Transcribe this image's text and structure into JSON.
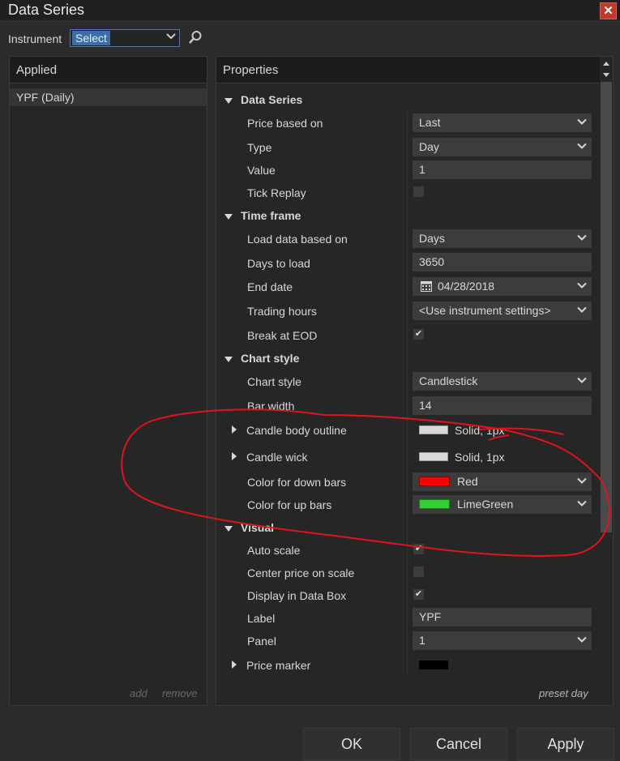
{
  "window": {
    "title": "Data Series",
    "close_icon": "close-icon"
  },
  "instrument": {
    "label": "Instrument",
    "value": "Select"
  },
  "applied": {
    "header": "Applied",
    "items": [
      "YPF (Daily)"
    ],
    "add_label": "add",
    "remove_label": "remove"
  },
  "properties": {
    "header": "Properties",
    "sections": {
      "data_series": "Data Series",
      "time_frame": "Time frame",
      "chart_style": "Chart style",
      "visual": "Visual"
    },
    "rows": {
      "price_based_on": {
        "label": "Price based on",
        "value": "Last"
      },
      "type": {
        "label": "Type",
        "value": "Day"
      },
      "value": {
        "label": "Value",
        "value": "1"
      },
      "tick_replay": {
        "label": "Tick Replay",
        "checked": false
      },
      "load_data_based_on": {
        "label": "Load data based on",
        "value": "Days"
      },
      "days_to_load": {
        "label": "Days to load",
        "value": "3650"
      },
      "end_date": {
        "label": "End date",
        "value": "04/28/2018"
      },
      "trading_hours": {
        "label": "Trading hours",
        "value": "<Use instrument settings>"
      },
      "break_at_eod": {
        "label": "Break at EOD",
        "checked": true
      },
      "chart_style": {
        "label": "Chart style",
        "value": "Candlestick"
      },
      "bar_width": {
        "label": "Bar width",
        "value": "14"
      },
      "candle_body_outline": {
        "label": "Candle body outline",
        "value": "Solid, 1px",
        "color": "#d9d9d9"
      },
      "candle_wick": {
        "label": "Candle wick",
        "value": "Solid, 1px",
        "color": "#d9d9d9"
      },
      "color_down_bars": {
        "label": "Color for down bars",
        "value": "Red",
        "color": "#ff0000"
      },
      "color_up_bars": {
        "label": "Color for up bars",
        "value": "LimeGreen",
        "color": "#32cd32"
      },
      "auto_scale": {
        "label": "Auto scale",
        "checked": true
      },
      "center_price_on_scale": {
        "label": "Center price on scale",
        "checked": false
      },
      "display_in_data_box": {
        "label": "Display in Data Box",
        "checked": true
      },
      "label": {
        "label": "Label",
        "value": "YPF"
      },
      "panel": {
        "label": "Panel",
        "value": "1"
      },
      "price_marker": {
        "label": "Price marker",
        "color": "#000000"
      }
    },
    "preset_label": "preset day"
  },
  "buttons": {
    "ok": "OK",
    "cancel": "Cancel",
    "apply": "Apply"
  },
  "annotation_color": "#e0141e"
}
